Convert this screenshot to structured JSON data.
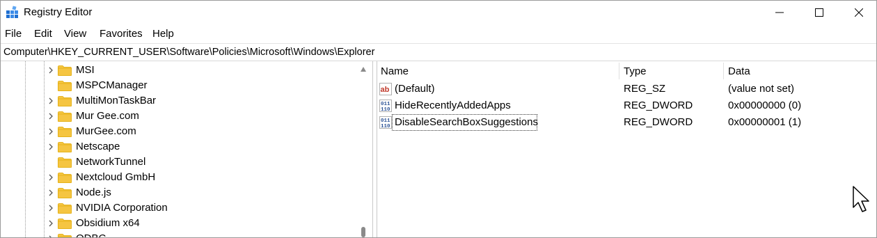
{
  "window": {
    "title": "Registry Editor",
    "controls": {
      "minimize": "—",
      "maximize": "☐",
      "close": "✕"
    }
  },
  "menu": [
    "File",
    "Edit",
    "View",
    "Favorites",
    "Help"
  ],
  "address": "Computer\\HKEY_CURRENT_USER\\Software\\Policies\\Microsoft\\Windows\\Explorer",
  "tree": [
    {
      "label": "MSI",
      "expandable": true
    },
    {
      "label": "MSPCManager",
      "expandable": false
    },
    {
      "label": "MultiMonTaskBar",
      "expandable": true
    },
    {
      "label": "Mur Gee.com",
      "expandable": true
    },
    {
      "label": "MurGee.com",
      "expandable": true
    },
    {
      "label": "Netscape",
      "expandable": true
    },
    {
      "label": "NetworkTunnel",
      "expandable": false
    },
    {
      "label": "Nextcloud GmbH",
      "expandable": true
    },
    {
      "label": "Node.js",
      "expandable": true
    },
    {
      "label": "NVIDIA Corporation",
      "expandable": true
    },
    {
      "label": "Obsidium x64",
      "expandable": true
    },
    {
      "label": "ODBC",
      "expandable": true
    }
  ],
  "list": {
    "headers": {
      "name": "Name",
      "type": "Type",
      "data": "Data"
    },
    "rows": [
      {
        "icon": "string-value-icon",
        "name": "(Default)",
        "type": "REG_SZ",
        "data": "(value not set)"
      },
      {
        "icon": "binary-value-icon",
        "name": "HideRecentlyAddedApps",
        "type": "REG_DWORD",
        "data": "0x00000000 (0)"
      },
      {
        "icon": "binary-value-icon",
        "name": "DisableSearchBoxSuggestions",
        "type": "REG_DWORD",
        "data": "0x00000001 (1)"
      }
    ]
  },
  "colors": {
    "folder": "#f5c542",
    "folder_dark": "#e0a800",
    "string_icon": "#c0392b",
    "binary_icon": "#2f5597"
  }
}
